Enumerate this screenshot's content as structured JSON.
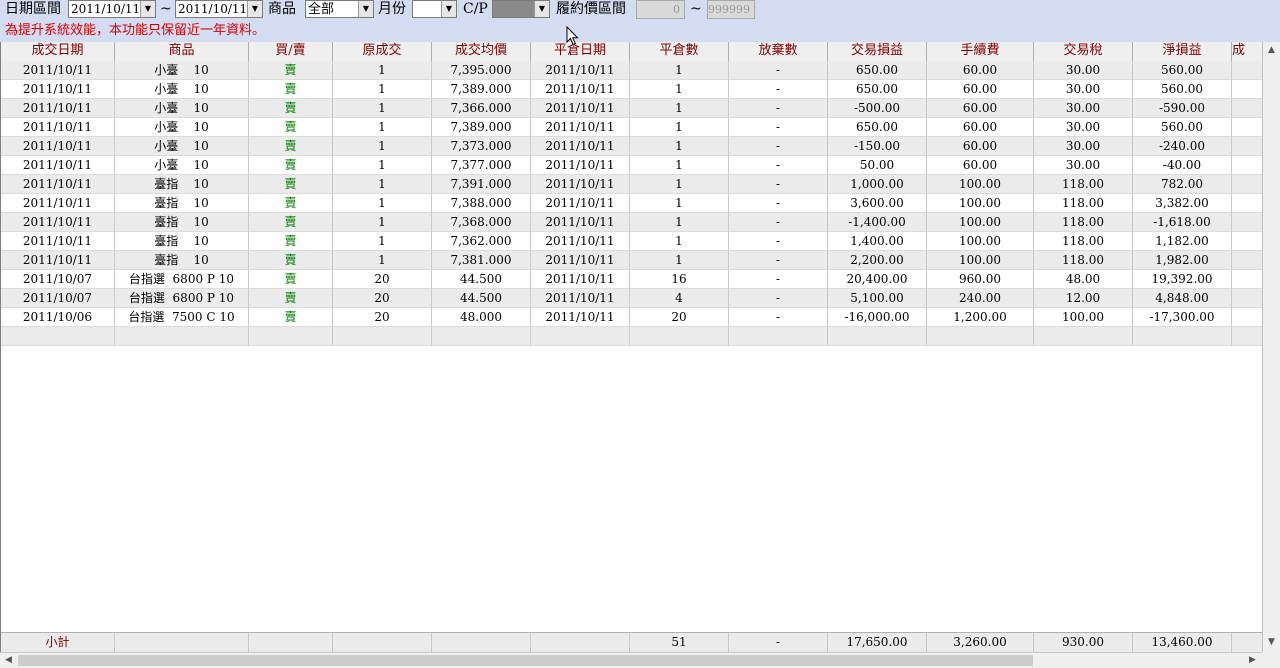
{
  "toolbar": {
    "date_range_label": "日期區間",
    "date_from": "2011/10/11",
    "tilde": "~",
    "date_to": "2011/10/11",
    "product_label": "商品",
    "product_value": "全部",
    "month_label": "月份",
    "month_value": "",
    "cp_label": "C/P",
    "cp_value": "",
    "strike_label": "履約價區間",
    "strike_from": "0",
    "strike_tilde": "~",
    "strike_to": "999999",
    "dropdown_arrow": "▼"
  },
  "notice": "為提升系統效能，本功能只保留近一年資料。",
  "table": {
    "columns": [
      "成交日期",
      "商品",
      "買/賣",
      "原成交",
      "成交均價",
      "平倉日期",
      "平倉數",
      "放棄數",
      "交易損益",
      "手續費",
      "交易稅",
      "淨損益",
      "成"
    ],
    "rows": [
      [
        "2011/10/11",
        "小臺    10",
        "賣",
        "1",
        "7,395.000",
        "2011/10/11",
        "1",
        "-",
        "650.00",
        "60.00",
        "30.00",
        "560.00"
      ],
      [
        "2011/10/11",
        "小臺    10",
        "賣",
        "1",
        "7,389.000",
        "2011/10/11",
        "1",
        "-",
        "650.00",
        "60.00",
        "30.00",
        "560.00"
      ],
      [
        "2011/10/11",
        "小臺    10",
        "賣",
        "1",
        "7,366.000",
        "2011/10/11",
        "1",
        "-",
        "-500.00",
        "60.00",
        "30.00",
        "-590.00"
      ],
      [
        "2011/10/11",
        "小臺    10",
        "賣",
        "1",
        "7,389.000",
        "2011/10/11",
        "1",
        "-",
        "650.00",
        "60.00",
        "30.00",
        "560.00"
      ],
      [
        "2011/10/11",
        "小臺    10",
        "賣",
        "1",
        "7,373.000",
        "2011/10/11",
        "1",
        "-",
        "-150.00",
        "60.00",
        "30.00",
        "-240.00"
      ],
      [
        "2011/10/11",
        "小臺    10",
        "賣",
        "1",
        "7,377.000",
        "2011/10/11",
        "1",
        "-",
        "50.00",
        "60.00",
        "30.00",
        "-40.00"
      ],
      [
        "2011/10/11",
        "臺指    10",
        "賣",
        "1",
        "7,391.000",
        "2011/10/11",
        "1",
        "-",
        "1,000.00",
        "100.00",
        "118.00",
        "782.00"
      ],
      [
        "2011/10/11",
        "臺指    10",
        "賣",
        "1",
        "7,388.000",
        "2011/10/11",
        "1",
        "-",
        "3,600.00",
        "100.00",
        "118.00",
        "3,382.00"
      ],
      [
        "2011/10/11",
        "臺指    10",
        "賣",
        "1",
        "7,368.000",
        "2011/10/11",
        "1",
        "-",
        "-1,400.00",
        "100.00",
        "118.00",
        "-1,618.00"
      ],
      [
        "2011/10/11",
        "臺指    10",
        "賣",
        "1",
        "7,362.000",
        "2011/10/11",
        "1",
        "-",
        "1,400.00",
        "100.00",
        "118.00",
        "1,182.00"
      ],
      [
        "2011/10/11",
        "臺指    10",
        "賣",
        "1",
        "7,381.000",
        "2011/10/11",
        "1",
        "-",
        "2,200.00",
        "100.00",
        "118.00",
        "1,982.00"
      ],
      [
        "2011/10/07",
        "台指選  6800 P 10",
        "賣",
        "20",
        "44.500",
        "2011/10/11",
        "16",
        "-",
        "20,400.00",
        "960.00",
        "48.00",
        "19,392.00"
      ],
      [
        "2011/10/07",
        "台指選  6800 P 10",
        "賣",
        "20",
        "44.500",
        "2011/10/11",
        "4",
        "-",
        "5,100.00",
        "240.00",
        "12.00",
        "4,848.00"
      ],
      [
        "2011/10/06",
        "台指選  7500 C 10",
        "賣",
        "20",
        "48.000",
        "2011/10/11",
        "20",
        "-",
        "-16,000.00",
        "1,200.00",
        "100.00",
        "-17,300.00"
      ]
    ],
    "footer": [
      "小計",
      "",
      "",
      "",
      "",
      "",
      "51",
      "-",
      "17,650.00",
      "3,260.00",
      "930.00",
      "13,460.00"
    ]
  },
  "scroll_icons": {
    "up": "▲",
    "down": "▼",
    "left": "◀",
    "right": "▶"
  }
}
